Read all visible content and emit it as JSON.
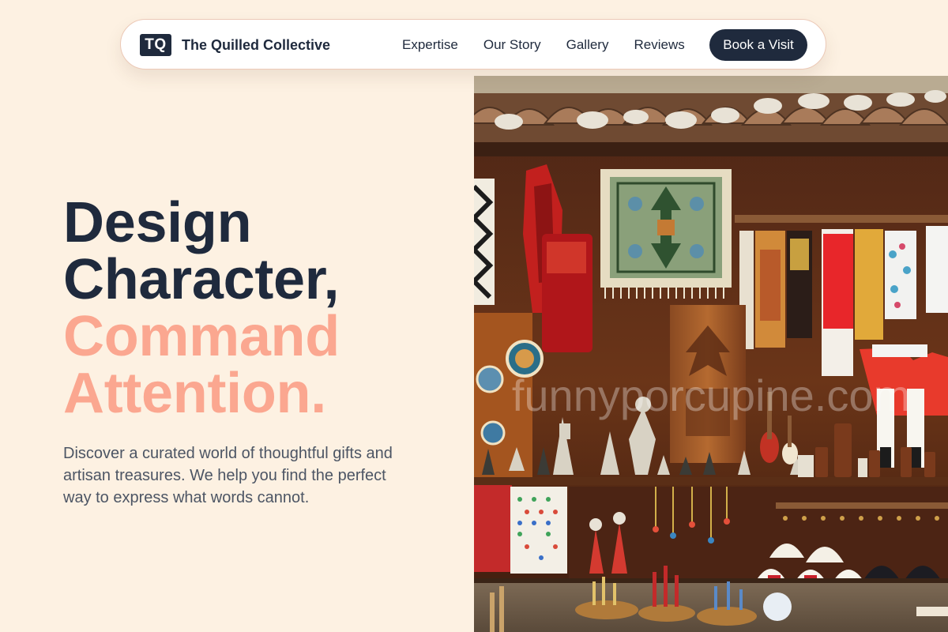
{
  "header": {
    "logo_text": "TQ",
    "brand_name": "The Quilled Collective",
    "nav": [
      {
        "label": "Expertise"
      },
      {
        "label": "Our Story"
      },
      {
        "label": "Gallery"
      },
      {
        "label": "Reviews"
      }
    ],
    "cta_label": "Book a Visit"
  },
  "hero": {
    "title_lines": [
      "Design",
      "Character,",
      "Command",
      "Attention."
    ],
    "subtitle": "Discover a curated world of thoughtful gifts and artisan treasures. We help you find the perfect way to express what words cannot.",
    "image": {
      "subject": "artisan-market-stall",
      "watermark": "funnyporcupine.com"
    }
  },
  "colors": {
    "page_background": "#fdf1e2",
    "navy": "#1f2a3d",
    "accent_salmon": "#fba790",
    "body_text": "#4c5564",
    "nav_border": "#ecc9b7"
  }
}
